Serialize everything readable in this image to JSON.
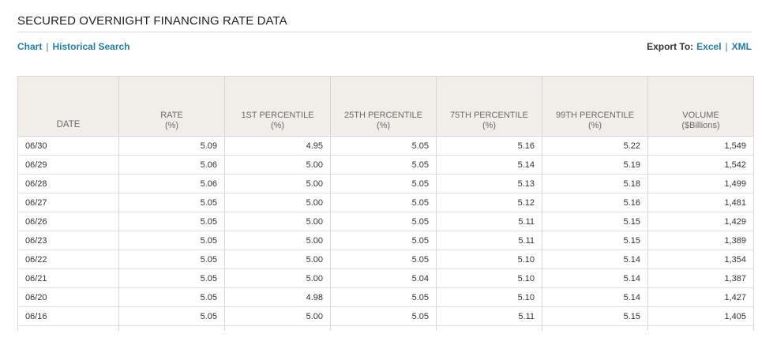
{
  "header": {
    "title": "SECURED OVERNIGHT FINANCING RATE DATA"
  },
  "nav": {
    "chart_label": "Chart",
    "separator": "|",
    "historical_label": "Historical Search"
  },
  "export": {
    "label": "Export To:",
    "excel_label": "Excel",
    "separator": "|",
    "xml_label": "XML"
  },
  "table": {
    "columns": [
      {
        "label": "DATE",
        "unit": ""
      },
      {
        "label": "RATE",
        "unit": "(%)"
      },
      {
        "label": "1ST PERCENTILE",
        "unit": "(%)"
      },
      {
        "label": "25TH PERCENTILE",
        "unit": "(%)"
      },
      {
        "label": "75TH PERCENTILE",
        "unit": "(%)"
      },
      {
        "label": "99TH PERCENTILE",
        "unit": "(%)"
      },
      {
        "label": "VOLUME",
        "unit": "($Billions)"
      }
    ],
    "rows": [
      [
        "06/30",
        "5.09",
        "4.95",
        "5.05",
        "5.16",
        "5.22",
        "1,549"
      ],
      [
        "06/29",
        "5.06",
        "5.00",
        "5.05",
        "5.14",
        "5.19",
        "1,542"
      ],
      [
        "06/28",
        "5.06",
        "5.00",
        "5.05",
        "5.13",
        "5.18",
        "1,499"
      ],
      [
        "06/27",
        "5.05",
        "5.00",
        "5.05",
        "5.12",
        "5.16",
        "1,481"
      ],
      [
        "06/26",
        "5.05",
        "5.00",
        "5.05",
        "5.11",
        "5.15",
        "1,429"
      ],
      [
        "06/23",
        "5.05",
        "5.00",
        "5.05",
        "5.11",
        "5.15",
        "1,389"
      ],
      [
        "06/22",
        "5.05",
        "5.00",
        "5.05",
        "5.10",
        "5.14",
        "1,354"
      ],
      [
        "06/21",
        "5.05",
        "5.00",
        "5.04",
        "5.10",
        "5.14",
        "1,387"
      ],
      [
        "06/20",
        "5.05",
        "4.98",
        "5.05",
        "5.10",
        "5.14",
        "1,427"
      ],
      [
        "06/16",
        "5.05",
        "5.00",
        "5.05",
        "5.11",
        "5.15",
        "1,405"
      ]
    ]
  }
}
